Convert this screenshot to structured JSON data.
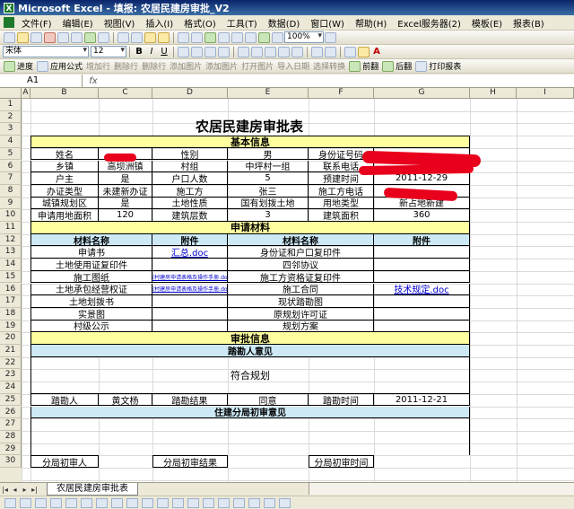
{
  "app": {
    "title": "Microsoft Excel - 填报: 农居民建房审批_V2",
    "icon": "excel-icon"
  },
  "menu": [
    "文件(F)",
    "编辑(E)",
    "视图(V)",
    "插入(I)",
    "格式(O)",
    "工具(T)",
    "数据(D)",
    "窗口(W)",
    "帮助(H)",
    "Excel服务器(2)",
    "模板(E)",
    "报表(B)"
  ],
  "toolbar": {
    "zoom": "100%",
    "font": "宋体",
    "font_size": "12"
  },
  "custom_toolbar": {
    "items": [
      "进度",
      "应用公式",
      "增加行",
      "删除行",
      "删除行",
      "添加图片",
      "添加图片",
      "打开图片",
      "导入日期",
      "选择转换"
    ],
    "right_items": [
      "前翻",
      "后翻",
      "打印报表"
    ]
  },
  "name_box": "A1",
  "fx_label": "fx",
  "columns": [
    "A",
    "B",
    "C",
    "D",
    "E",
    "F",
    "G",
    "H",
    "I"
  ],
  "rows": [
    "1",
    "2",
    "3",
    "4",
    "5",
    "6",
    "7",
    "8",
    "9",
    "10",
    "11",
    "12",
    "13",
    "14",
    "15",
    "16",
    "17",
    "18",
    "19",
    "20",
    "21",
    "22",
    "23",
    "24",
    "25",
    "26",
    "27",
    "28",
    "29",
    "30"
  ],
  "sheet": {
    "title": "农居民建房审批表",
    "sections": {
      "basic": "基本信息",
      "materials": "申请材料",
      "review": "审批信息",
      "survey": "踏勘人意见",
      "initial_review": "住建分局初审意见"
    },
    "basic_info": [
      [
        "姓名",
        "",
        "性别",
        "男",
        "身份证号码",
        ""
      ],
      [
        "乡镇",
        "高坝洲镇",
        "村组",
        "中坪村一组",
        "联系电话",
        ""
      ],
      [
        "户主",
        "是",
        "户口人数",
        "5",
        "预建时间",
        "2011-12-29"
      ],
      [
        "办证类型",
        "未建新办证",
        "施工方",
        "张三",
        "施工方电话",
        ""
      ],
      [
        "城镇规划区",
        "是",
        "土地性质",
        "国有划拨土地",
        "用地类型",
        "新占地新建"
      ],
      [
        "申请用地面积",
        "120",
        "建筑层数",
        "3",
        "建筑面积",
        "360"
      ]
    ],
    "materials_headers": [
      "材料名称",
      "附件",
      "材料名称",
      "附件"
    ],
    "materials": [
      [
        "申请书",
        "汇总.doc",
        "身份证和户口复印件",
        ""
      ],
      [
        "土地使用证复印件",
        "",
        "四邻协议",
        ""
      ],
      [
        "施工图纸",
        "农村建房申请表格及操作手册.doc",
        "施工方资格证复印件",
        ""
      ],
      [
        "土地承包经营权证",
        "农村建房申请表格及操作手册.doc",
        "施工合同",
        "技术规定.doc"
      ],
      [
        "土地划拨书",
        "",
        "现状踏勘图",
        ""
      ],
      [
        "实景图",
        "",
        "原规划许可证",
        ""
      ],
      [
        "村级公示",
        "",
        "规划方案",
        ""
      ]
    ],
    "survey_opinion": "符合规划",
    "survey_row": [
      "踏勘人",
      "黄文杨",
      "踏勘结果",
      "同意",
      "踏勘时间",
      "2011-12-21"
    ],
    "initial_row": [
      "分局初审人",
      "分局初审结果",
      "分局初审时间"
    ]
  },
  "sheet_tab": "农居民建房审批表",
  "colors": {
    "section": "#ffffa0",
    "subheader": "#cde9f6",
    "redaction": "#e8001c",
    "link": "#0000cc"
  }
}
